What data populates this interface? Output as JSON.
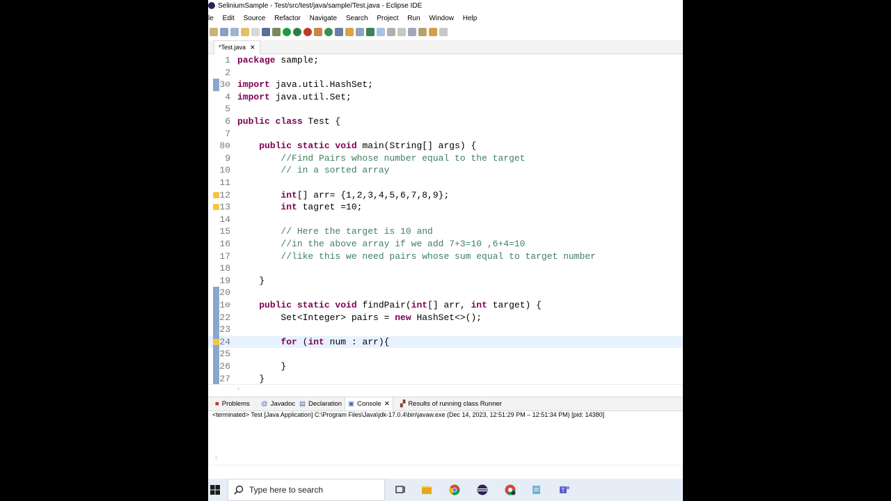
{
  "window": {
    "title": "SeliniumSample - Test/src/test/java/sample/Test.java - Eclipse IDE"
  },
  "menu": [
    "le",
    "Edit",
    "Source",
    "Refactor",
    "Navigate",
    "Search",
    "Project",
    "Run",
    "Window",
    "Help"
  ],
  "editor_tab": {
    "label": "*Test.java",
    "close": "✕"
  },
  "code_lines": [
    {
      "n": "1",
      "parts": [
        {
          "t": "package",
          "c": "kw"
        },
        {
          "t": " sample;",
          "c": ""
        }
      ]
    },
    {
      "n": "2",
      "parts": []
    },
    {
      "n": "3⊖",
      "parts": [
        {
          "t": "import",
          "c": "kw"
        },
        {
          "t": " java.util.HashSet;",
          "c": ""
        }
      ]
    },
    {
      "n": "4",
      "parts": [
        {
          "t": "import",
          "c": "kw"
        },
        {
          "t": " java.util.Set;",
          "c": ""
        }
      ]
    },
    {
      "n": "5",
      "parts": []
    },
    {
      "n": "6",
      "parts": [
        {
          "t": "public class",
          "c": "kw"
        },
        {
          "t": " Test {",
          "c": ""
        }
      ]
    },
    {
      "n": "7",
      "parts": []
    },
    {
      "n": "8⊖",
      "parts": [
        {
          "t": "    ",
          "c": ""
        },
        {
          "t": "public static void",
          "c": "kw"
        },
        {
          "t": " main(String[] args) {",
          "c": ""
        }
      ]
    },
    {
      "n": "9",
      "parts": [
        {
          "t": "        //Find Pairs whose number equal to the target",
          "c": "cm"
        }
      ]
    },
    {
      "n": "10",
      "parts": [
        {
          "t": "        // in a sorted array",
          "c": "cm"
        }
      ]
    },
    {
      "n": "11",
      "parts": []
    },
    {
      "n": "12",
      "parts": [
        {
          "t": "        ",
          "c": ""
        },
        {
          "t": "int",
          "c": "kw"
        },
        {
          "t": "[] arr= {1,2,3,4,5,6,7,8,9};",
          "c": ""
        }
      ]
    },
    {
      "n": "13",
      "parts": [
        {
          "t": "        ",
          "c": ""
        },
        {
          "t": "int",
          "c": "kw"
        },
        {
          "t": " tagret =10;",
          "c": ""
        }
      ]
    },
    {
      "n": "14",
      "parts": []
    },
    {
      "n": "15",
      "parts": [
        {
          "t": "        // Here the target is 10 and",
          "c": "cm"
        }
      ]
    },
    {
      "n": "16",
      "parts": [
        {
          "t": "        //in the above array if we add 7+3=10 ,6+4=10",
          "c": "cm"
        }
      ]
    },
    {
      "n": "17",
      "parts": [
        {
          "t": "        //like this we need pairs whose sum equal to target number",
          "c": "cm"
        }
      ]
    },
    {
      "n": "18",
      "parts": []
    },
    {
      "n": "19",
      "parts": [
        {
          "t": "    }",
          "c": ""
        }
      ]
    },
    {
      "n": "20",
      "parts": []
    },
    {
      "n": "21⊖",
      "parts": [
        {
          "t": "    ",
          "c": ""
        },
        {
          "t": "public static void",
          "c": "kw"
        },
        {
          "t": " findPair(",
          "c": ""
        },
        {
          "t": "int",
          "c": "kw"
        },
        {
          "t": "[] arr, ",
          "c": ""
        },
        {
          "t": "int",
          "c": "kw"
        },
        {
          "t": " target) {",
          "c": ""
        }
      ]
    },
    {
      "n": "22",
      "parts": [
        {
          "t": "        Set<Integer> pairs = ",
          "c": ""
        },
        {
          "t": "new",
          "c": "kw"
        },
        {
          "t": " HashSet<>();",
          "c": ""
        }
      ]
    },
    {
      "n": "23",
      "parts": []
    },
    {
      "n": "24",
      "parts": [
        {
          "t": "        ",
          "c": ""
        },
        {
          "t": "for",
          "c": "kw"
        },
        {
          "t": " (",
          "c": ""
        },
        {
          "t": "int",
          "c": "kw"
        },
        {
          "t": " num : arr){",
          "c": ""
        }
      ]
    },
    {
      "n": "25",
      "parts": []
    },
    {
      "n": "26",
      "parts": [
        {
          "t": "        }",
          "c": ""
        }
      ]
    },
    {
      "n": "27",
      "parts": [
        {
          "t": "    }",
          "c": ""
        }
      ]
    }
  ],
  "console_tabs": [
    "Problems",
    "Javadoc",
    "Declaration",
    "Console",
    "Results of running class Runner"
  ],
  "console_status": "<terminated> Test [Java Application] C:\\Program Files\\Java\\jdk-17.0.4\\bin\\javaw.exe  (Dec 14, 2023, 12:51:29 PM – 12:51:34 PM) [pid: 14380]",
  "taskbar": {
    "search_placeholder": "Type here to search"
  }
}
